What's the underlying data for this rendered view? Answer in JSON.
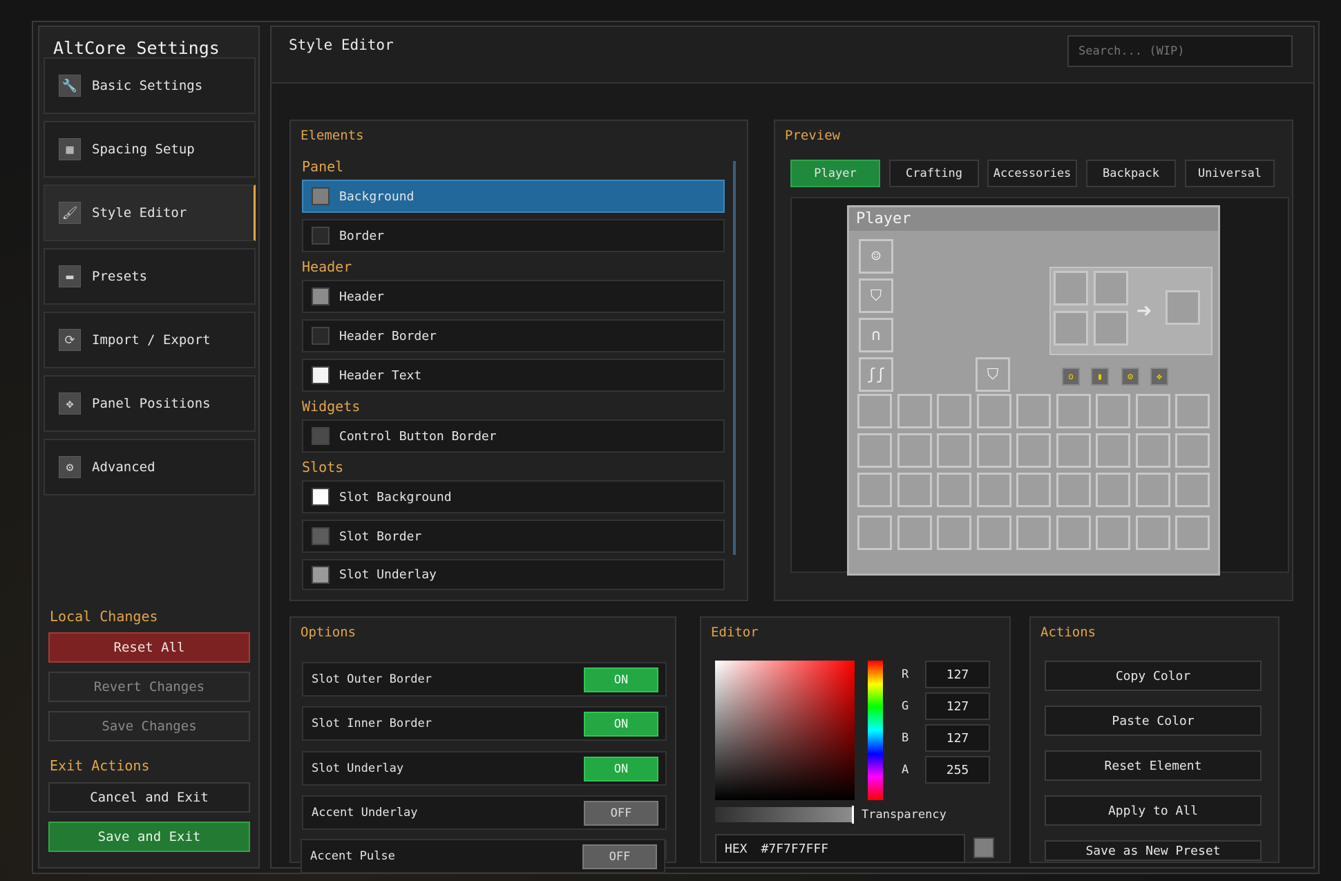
{
  "app_title": "AltCore Settings",
  "sidebar": {
    "items": [
      {
        "label": "Basic Settings",
        "icon": "wrench-icon",
        "glyph": "🔧"
      },
      {
        "label": "Spacing Setup",
        "icon": "grid-icon",
        "glyph": "▦"
      },
      {
        "label": "Style Editor",
        "icon": "brush-icon",
        "glyph": "🖌"
      },
      {
        "label": "Presets",
        "icon": "folder-icon",
        "glyph": "▬"
      },
      {
        "label": "Import / Export",
        "icon": "cycle-icon",
        "glyph": "⟳"
      },
      {
        "label": "Panel Positions",
        "icon": "move-icon",
        "glyph": "✥"
      },
      {
        "label": "Advanced",
        "icon": "gear-icon",
        "glyph": "⚙"
      }
    ],
    "active_index": 2,
    "local_changes_label": "Local Changes",
    "reset_all": "Reset All",
    "revert_changes": "Revert Changes",
    "save_changes": "Save Changes",
    "exit_actions_label": "Exit Actions",
    "cancel_and_exit": "Cancel and Exit",
    "save_and_exit": "Save and Exit"
  },
  "main": {
    "title": "Style Editor",
    "search_placeholder": "Search... (WIP)"
  },
  "elements": {
    "title": "Elements",
    "groups": [
      {
        "label": "Panel",
        "items": [
          {
            "label": "Background",
            "color": "#7f7f7f",
            "selected": true
          },
          {
            "label": "Border",
            "color": "#2a2a2a"
          }
        ]
      },
      {
        "label": "Header",
        "items": [
          {
            "label": "Header",
            "color": "#8b8b8b"
          },
          {
            "label": "Header Border",
            "color": "#2a2a2a"
          },
          {
            "label": "Header Text",
            "color": "#f4f4f4"
          }
        ]
      },
      {
        "label": "Widgets",
        "items": [
          {
            "label": "Control Button Border",
            "color": "#4a4a4a"
          }
        ]
      },
      {
        "label": "Slots",
        "items": [
          {
            "label": "Slot Background",
            "color": "#ffffff"
          },
          {
            "label": "Slot Border",
            "color": "#5c5c5c"
          },
          {
            "label": "Slot Underlay",
            "color": "#9a9a9a"
          }
        ]
      }
    ]
  },
  "preview": {
    "title": "Preview",
    "tabs": [
      "Player",
      "Crafting",
      "Accessories",
      "Backpack",
      "Universal"
    ],
    "active_tab": 0,
    "inventory_title": "Player",
    "armor_icons": [
      "☺",
      "⛉",
      "∩",
      "ʃʃ"
    ],
    "mini_icons": [
      "o",
      "▮",
      "⚙",
      "✥"
    ]
  },
  "options": {
    "title": "Options",
    "rows": [
      {
        "label": "Slot Outer Border",
        "state": "ON"
      },
      {
        "label": "Slot Inner Border",
        "state": "ON"
      },
      {
        "label": "Slot Underlay",
        "state": "ON"
      },
      {
        "label": "Accent Underlay",
        "state": "OFF"
      },
      {
        "label": "Accent Pulse",
        "state": "OFF"
      }
    ]
  },
  "editor": {
    "title": "Editor",
    "channels": [
      {
        "label": "R",
        "value": "127"
      },
      {
        "label": "G",
        "value": "127"
      },
      {
        "label": "B",
        "value": "127"
      },
      {
        "label": "A",
        "value": "255"
      }
    ],
    "transparency_label": "Transparency",
    "hex_label": "HEX",
    "hex_value": "#7F7F7FFF",
    "current_color": "#7f7f7f"
  },
  "actions": {
    "title": "Actions",
    "buttons": [
      "Copy Color",
      "Paste Color",
      "Reset Element",
      "Apply to All",
      "Save as New Preset"
    ]
  },
  "colors": {
    "accent": "#e3a64a",
    "selected": "#22689a",
    "on": "#23a844",
    "danger": "#7d2222",
    "confirm": "#237a33"
  }
}
